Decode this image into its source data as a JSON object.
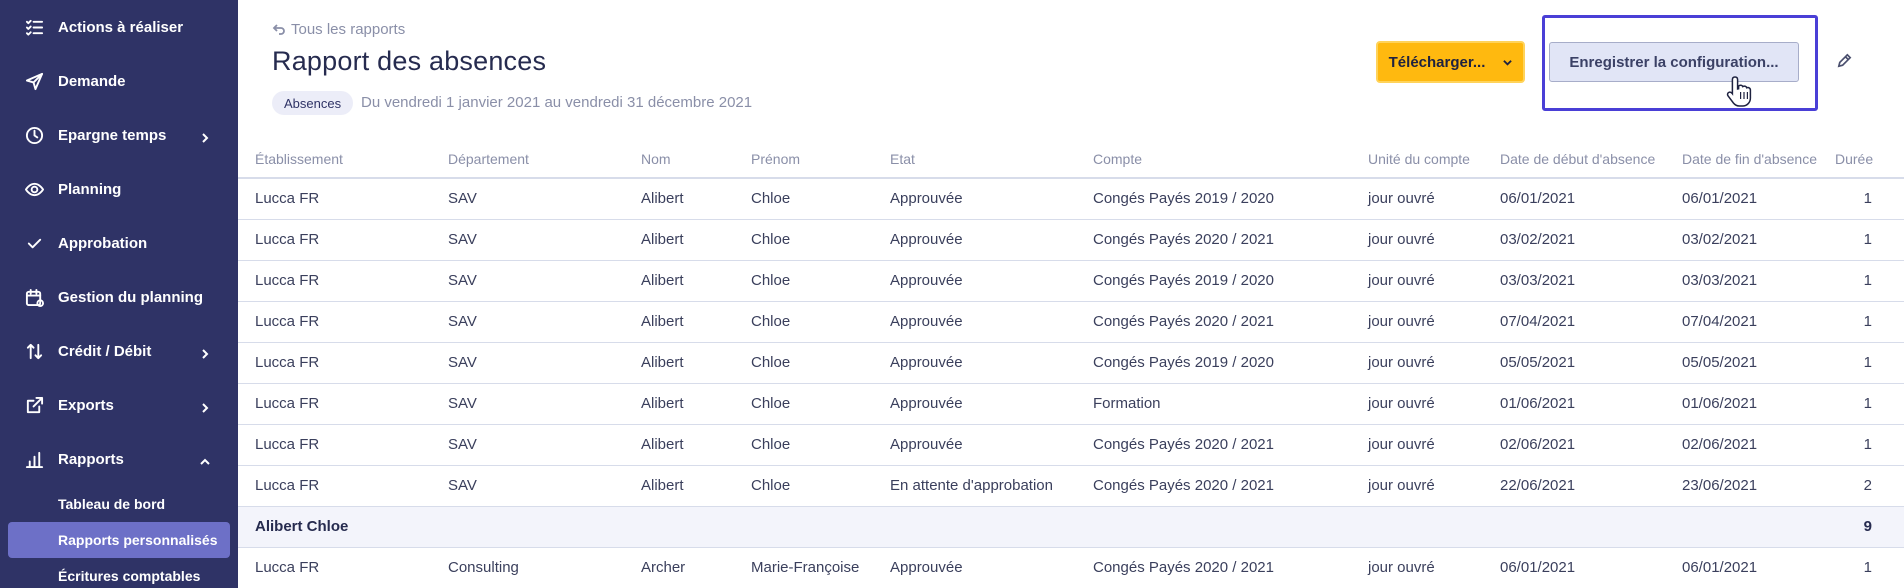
{
  "sidebar": {
    "items": [
      {
        "label": "Actions à réaliser",
        "icon": "checklist-icon",
        "has_chevron": false
      },
      {
        "label": "Demande",
        "icon": "send-icon",
        "has_chevron": false
      },
      {
        "label": "Epargne temps",
        "icon": "clock-icon",
        "has_chevron": true,
        "chevron": "right"
      },
      {
        "label": "Planning",
        "icon": "eye-icon",
        "has_chevron": false
      },
      {
        "label": "Approbation",
        "icon": "check-icon",
        "has_chevron": false
      },
      {
        "label": "Gestion du planning",
        "icon": "calendar-icon",
        "has_chevron": false
      },
      {
        "label": "Crédit / Débit",
        "icon": "arrows-updown-icon",
        "has_chevron": true,
        "chevron": "right"
      },
      {
        "label": "Exports",
        "icon": "external-link-icon",
        "has_chevron": true,
        "chevron": "right"
      },
      {
        "label": "Rapports",
        "icon": "bar-chart-icon",
        "has_chevron": true,
        "chevron": "up"
      }
    ],
    "sub_items": [
      {
        "label": "Tableau de bord",
        "active": false
      },
      {
        "label": "Rapports personnalisés",
        "active": true
      },
      {
        "label": "Écritures comptables",
        "active": false
      }
    ]
  },
  "header": {
    "back_label": "Tous les rapports",
    "title": "Rapport des absences",
    "tag": "Absences",
    "period": "Du vendredi 1 janvier 2021 au vendredi 31 décembre 2021",
    "download_label": "Télécharger...",
    "save_label": "Enregistrer la configuration..."
  },
  "colors": {
    "sidebar_bg": "#2f3366",
    "active_item_bg": "#6d70c7",
    "download_bg": "#ffb90f",
    "focus_frame": "#4a3fd6"
  },
  "table": {
    "columns": [
      "Établissement",
      "Département",
      "Nom",
      "Prénom",
      "Etat",
      "Compte",
      "Unité du compte",
      "Date de début d'absence",
      "Date de fin d'absence",
      "Durée"
    ],
    "rows": [
      [
        "Lucca FR",
        "SAV",
        "Alibert",
        "Chloe",
        "Approuvée",
        "Congés Payés 2019 / 2020",
        "jour ouvré",
        "06/01/2021",
        "06/01/2021",
        "1"
      ],
      [
        "Lucca FR",
        "SAV",
        "Alibert",
        "Chloe",
        "Approuvée",
        "Congés Payés 2020 / 2021",
        "jour ouvré",
        "03/02/2021",
        "03/02/2021",
        "1"
      ],
      [
        "Lucca FR",
        "SAV",
        "Alibert",
        "Chloe",
        "Approuvée",
        "Congés Payés 2019 / 2020",
        "jour ouvré",
        "03/03/2021",
        "03/03/2021",
        "1"
      ],
      [
        "Lucca FR",
        "SAV",
        "Alibert",
        "Chloe",
        "Approuvée",
        "Congés Payés 2020 / 2021",
        "jour ouvré",
        "07/04/2021",
        "07/04/2021",
        "1"
      ],
      [
        "Lucca FR",
        "SAV",
        "Alibert",
        "Chloe",
        "Approuvée",
        "Congés Payés 2019 / 2020",
        "jour ouvré",
        "05/05/2021",
        "05/05/2021",
        "1"
      ],
      [
        "Lucca FR",
        "SAV",
        "Alibert",
        "Chloe",
        "Approuvée",
        "Formation",
        "jour ouvré",
        "01/06/2021",
        "01/06/2021",
        "1"
      ],
      [
        "Lucca FR",
        "SAV",
        "Alibert",
        "Chloe",
        "Approuvée",
        "Congés Payés 2020 / 2021",
        "jour ouvré",
        "02/06/2021",
        "02/06/2021",
        "1"
      ],
      [
        "Lucca FR",
        "SAV",
        "Alibert",
        "Chloe",
        "En attente d'approbation",
        "Congés Payés 2020 / 2021",
        "jour ouvré",
        "22/06/2021",
        "23/06/2021",
        "2"
      ]
    ],
    "total": {
      "label": "Alibert Chloe",
      "value": "9"
    },
    "rows_after": [
      [
        "Lucca FR",
        "Consulting",
        "Archer",
        "Marie-Françoise",
        "Approuvée",
        "Congés Payés 2020 / 2021",
        "jour ouvré",
        "06/01/2021",
        "06/01/2021",
        "1"
      ]
    ]
  }
}
